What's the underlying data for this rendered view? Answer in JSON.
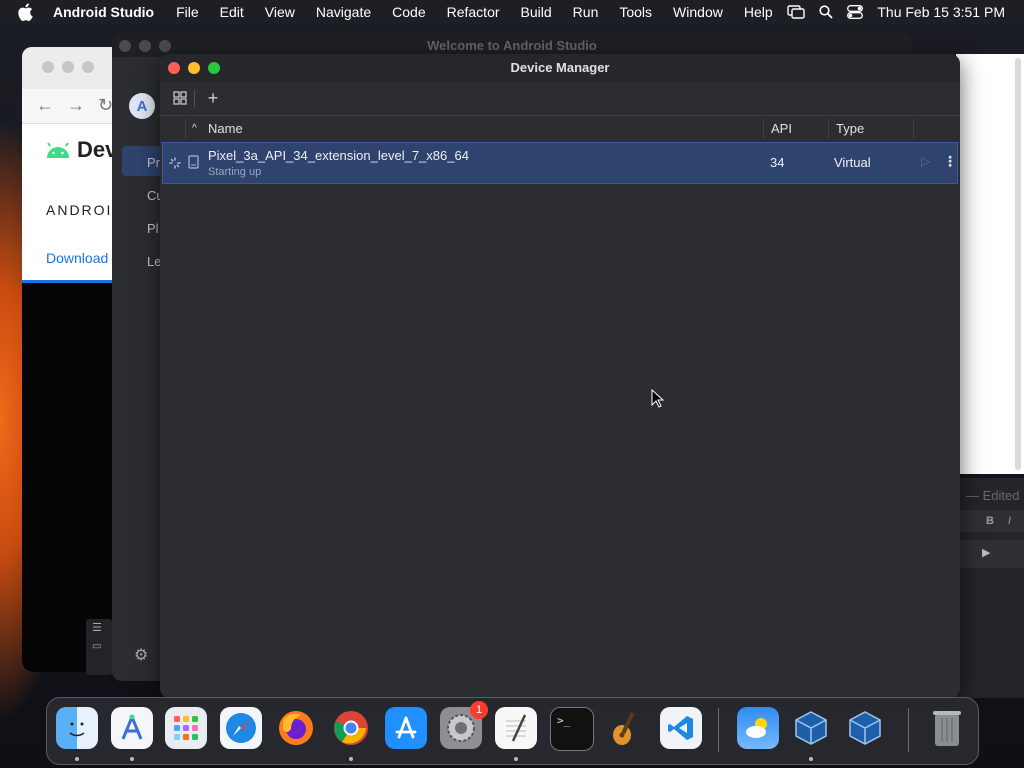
{
  "menubar": {
    "app_name": "Android Studio",
    "menus": [
      "File",
      "Edit",
      "View",
      "Navigate",
      "Code",
      "Refactor",
      "Build",
      "Run",
      "Tools",
      "Window",
      "Help"
    ],
    "clock": "Thu Feb 15  3:51 PM",
    "status_icons": [
      "screen-mirror-icon",
      "search-icon",
      "control-center-icon"
    ]
  },
  "browser": {
    "logo_text": "Dev",
    "section_text": "ANDROID",
    "tab_text": "Download"
  },
  "welcome": {
    "title": "Welcome to Android Studio",
    "sidebar": [
      "Pr",
      "Cu",
      "Pl",
      "Le"
    ]
  },
  "device_manager": {
    "title": "Device Manager",
    "columns": {
      "name": "Name",
      "api": "API",
      "type": "Type"
    },
    "devices": [
      {
        "name": "Pixel_3a_API_34_extension_level_7_x86_64",
        "status": "Starting up",
        "api": "34",
        "type": "Virtual"
      }
    ]
  },
  "right_panel": {
    "edited": "— Edited",
    "bold": "B",
    "italic": "I"
  },
  "dock": {
    "apps": [
      "finder-icon",
      "android-studio-icon",
      "launchpad-icon",
      "safari-icon",
      "firefox-icon",
      "chrome-icon",
      "app-store-icon",
      "system-settings-icon",
      "textedit-icon",
      "terminal-icon",
      "garageband-icon",
      "vscode-icon",
      "weather-icon",
      "virtualbox-icon",
      "virtualbox-vm-icon",
      "trash-icon"
    ],
    "settings_badge": "1"
  },
  "colors": {
    "selection": "#2e436e",
    "window_bg": "#2b2d30",
    "accent": "#3b5998"
  }
}
